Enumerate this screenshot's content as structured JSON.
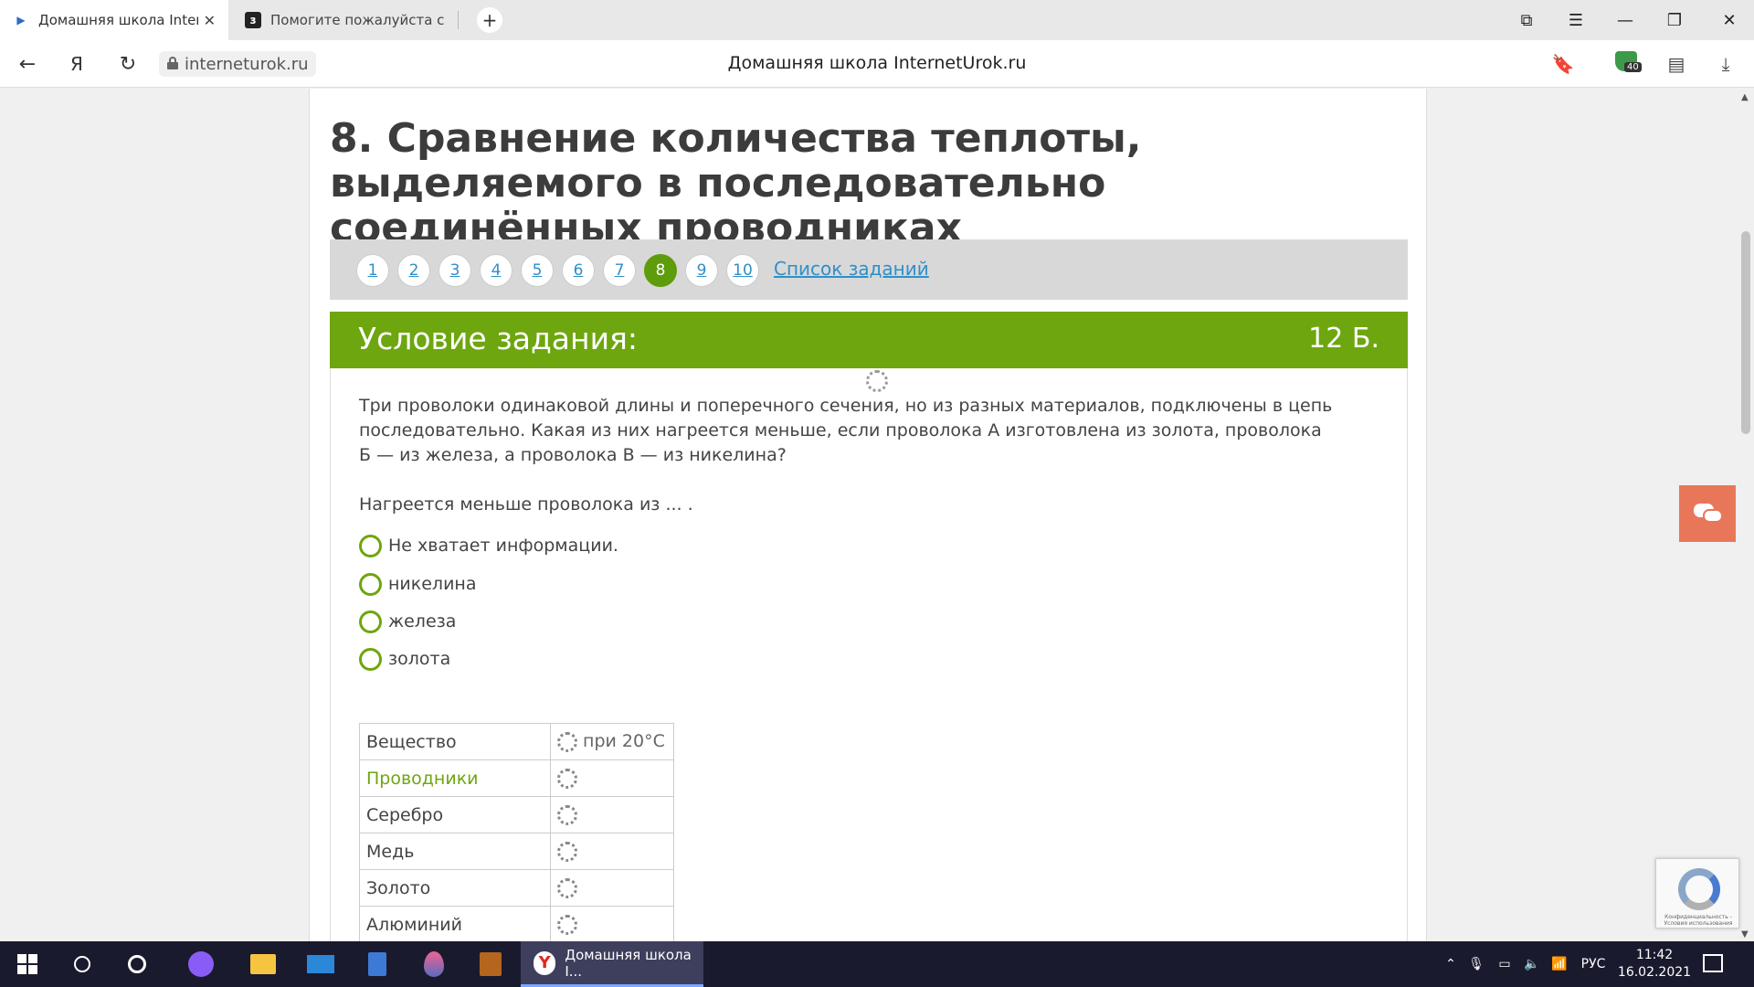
{
  "browser": {
    "tabs": [
      {
        "label": "Домашняя школа InternetUrok.ru",
        "active": true
      },
      {
        "label": "Помогите пожалуйста срочно",
        "active": false
      }
    ],
    "new_tab": "+",
    "window_controls": {
      "menu": "☰",
      "minimize": "—",
      "restore": "❐",
      "close": "✕"
    },
    "url": "interneturok.ru",
    "page_title": "Домашняя школа InternetUrok.ru",
    "ext_badge_count": "40",
    "yandex_button": "Я"
  },
  "page": {
    "heading": "8. Сравнение количества теплоты, выделяемого в последовательно соединённых проводниках",
    "pager": {
      "numbers": [
        "1",
        "2",
        "3",
        "4",
        "5",
        "6",
        "7",
        "8",
        "9",
        "10"
      ],
      "current": "8",
      "list_link": "Список заданий"
    },
    "task": {
      "title": "Условие задания:",
      "points": "12 Б.",
      "text": "Три проволоки одинаковой длины и поперечного сечения, но из разных материалов, подключены в цепь последовательно. Какая из них нагреется меньше, если проволока А изготовлена из золота, проволока Б — из железа, а проволока В — из никелина?",
      "question": "Нагреется меньше проволока из ... .",
      "options": [
        "Не хватает информации.",
        "никелина",
        "железа",
        "золота"
      ]
    },
    "table": {
      "header": [
        "Вещество",
        "при 20°C"
      ],
      "rows": [
        "Проводники",
        "Серебро",
        "Медь",
        "Золото",
        "Алюминий"
      ]
    },
    "recaptcha_text": "Конфиденциальность - Условия использования"
  },
  "taskbar": {
    "active_app_label": "Домашняя школа I...",
    "language": "РУС",
    "time": "11:42",
    "date": "16.02.2021"
  },
  "colors": {
    "accent_green": "#6ea60f",
    "link_blue": "#2f8fc9",
    "chat_orange": "#e8775a"
  }
}
